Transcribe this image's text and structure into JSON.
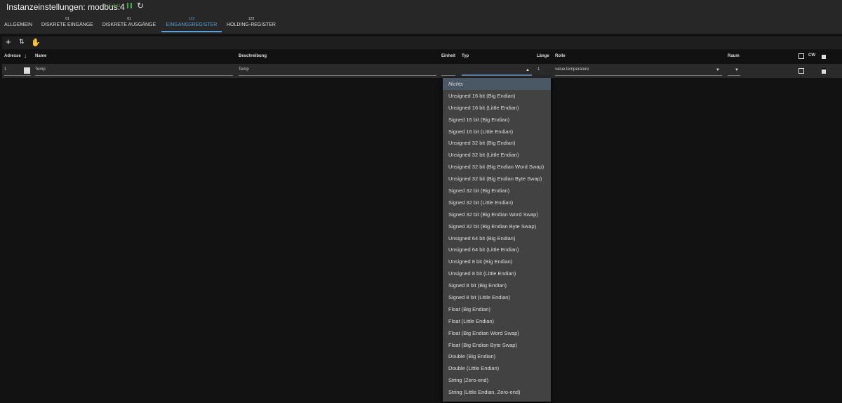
{
  "header": {
    "title": "Instanzeinstellungen: modbus.4",
    "version": "v5.0.11"
  },
  "tabs": [
    {
      "num": "",
      "label": "ALLGEMEIN"
    },
    {
      "num": "01",
      "label": "DISKRETE EINGÄNGE"
    },
    {
      "num": "01",
      "label": "DISKRETE AUSGÄNGE"
    },
    {
      "num": "123",
      "label": "EINGANGSREGISTER"
    },
    {
      "num": "123",
      "label": "HOLDING-REGISTER"
    }
  ],
  "columns": {
    "address": "Adresse",
    "name": "Name",
    "description": "Beschreibung",
    "unit": "Einheit",
    "type": "Typ",
    "length": "Länge",
    "role": "Rolle",
    "room": "Raum",
    "cw": "CW"
  },
  "row": {
    "address": "1",
    "name": "Temp",
    "description": "Temp",
    "length": "1",
    "role": "value.temperature"
  },
  "type_options": [
    "Nichts",
    "Unsigned 16 bit (Big Endian)",
    "Unsigned 16 bit (Little Endian)",
    "Signed 16 bit (Big Endian)",
    "Signed 16 bit (Little Endian)",
    "Unsigned 32 bit (Big Endian)",
    "Unsigned 32 bit (Little Endian)",
    "Unsigned 32 bit (Big Endian Word Swap)",
    "Unsigned 32 bit (Big Endian Byte Swap)",
    "Signed 32 bit (Big Endian)",
    "Signed 32 bit (Little Endian)",
    "Signed 32 bit (Big Endian Word Swap)",
    "Signed 32 bit (Big Endian Byte Swap)",
    "Unsigned 64 bit (Big Endian)",
    "Unsigned 64 bit (Little Endian)",
    "Unsigned 8 bit (Big Endian)",
    "Unsigned 8 bit (Little Endian)",
    "Signed 8 bit (Big Endian)",
    "Signed 8 bit (Little Endian)",
    "Float (Big Endian)",
    "Float (Little Endian)",
    "Float (Big Endian Word Swap)",
    "Float (Big Endian Byte Swap)",
    "Double (Big Endian)",
    "Double (Little Endian)",
    "String (Zero-end)",
    "String (Little Endian, Zero-end)"
  ]
}
